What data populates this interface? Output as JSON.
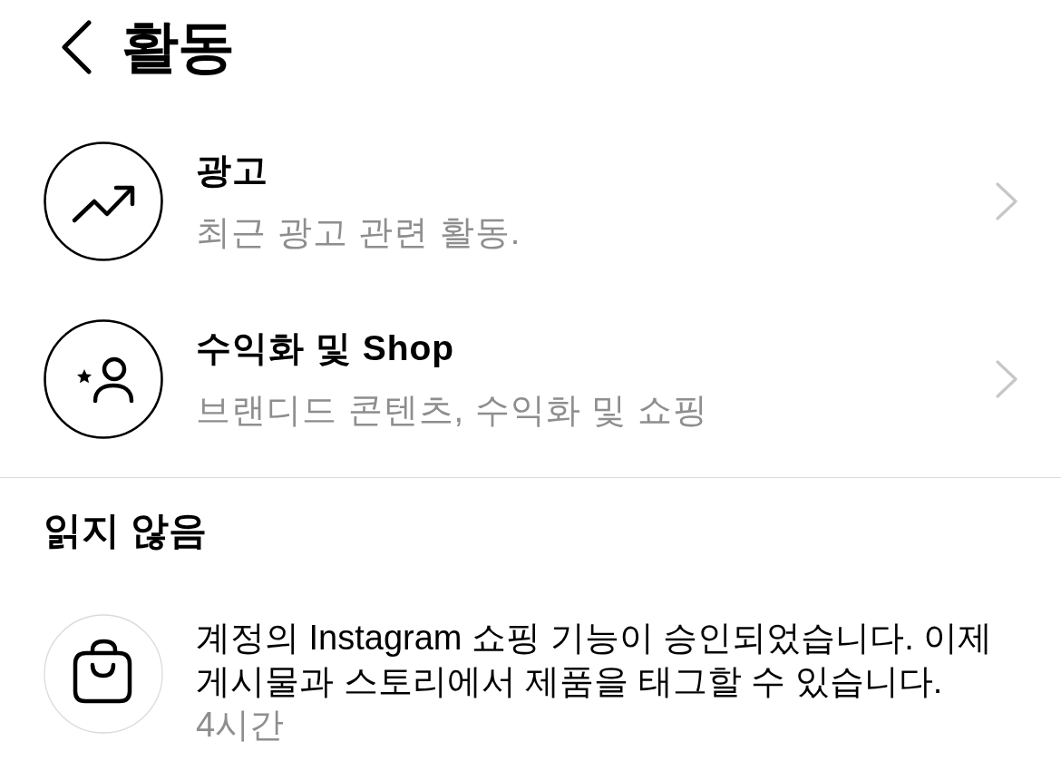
{
  "header": {
    "title": "활동"
  },
  "categories": [
    {
      "title": "광고",
      "subtitle": "최근 광고 관련 활동."
    },
    {
      "title": "수익화 및 Shop",
      "subtitle": "브랜디드 콘텐츠, 수익화 및 쇼핑"
    }
  ],
  "unread_section": {
    "title": "읽지 않음",
    "notifications": [
      {
        "message": "계정의 Instagram 쇼핑 기능이 승인되었습니다. 이제 게시물과 스토리에서 제품을 태그할 수 있습니다.",
        "time": "4시간"
      }
    ]
  }
}
